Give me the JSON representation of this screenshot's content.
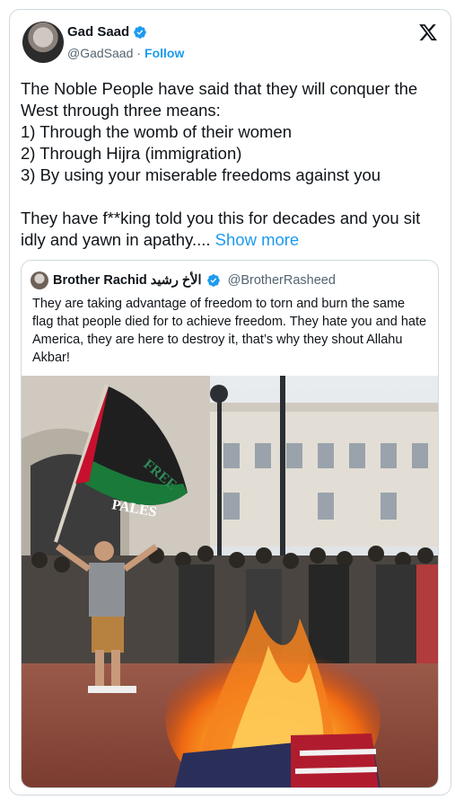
{
  "author": {
    "name": "Gad Saad",
    "handle": "@GadSaad",
    "separator": "·",
    "follow_label": "Follow"
  },
  "header_icon": "x-logo-icon",
  "tweet": {
    "text": "The Noble People have said that they will conquer the West through three means:\n1) Through the womb of their women\n2) Through Hijra (immigration)\n3) By using your miserable freedoms against you\n\nThey have f**king told you this for decades and you sit idly and yawn in apathy....",
    "show_more": "Show more"
  },
  "quote": {
    "name": "Brother Rachid الأخ رشيد",
    "handle": "@BrotherRasheed",
    "text": "They are taking advantage of freedom to torn and burn the same flag that people died for to achieve freedom. They hate you and hate America, they are here to destroy it, that’s why they shout Allahu Akbar!",
    "flag_text_1": "FREE",
    "flag_text_2": "PALES"
  },
  "colors": {
    "accent": "#1d9bf0",
    "text": "#0f1419",
    "muted": "#536471",
    "border": "#cfd9de"
  }
}
